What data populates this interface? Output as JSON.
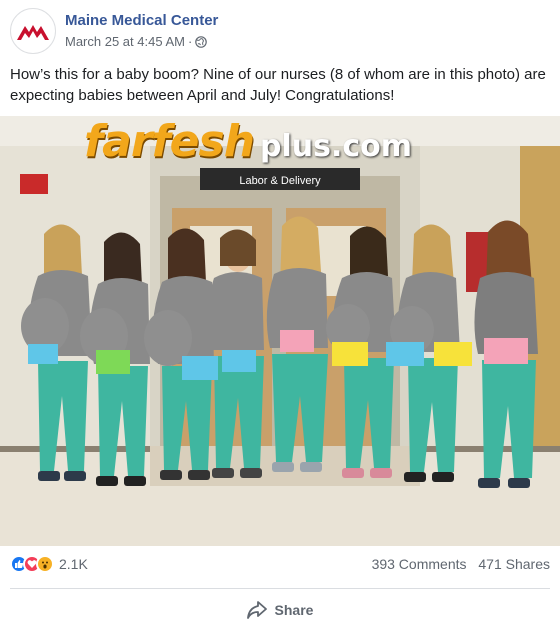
{
  "post": {
    "page_name": "Maine Medical Center",
    "timestamp": "March 25 at 4:45 AM",
    "separator": "·",
    "privacy_icon": "globe-icon",
    "text": "How’s this for a baby boom? Nine of our nurses (8 of whom are in this photo) are expecting babies between April and July! Congratulations!"
  },
  "photo": {
    "sign_text": "Labor & Delivery",
    "watermark_part1": "farfesh",
    "watermark_part2": "plus.com"
  },
  "stats": {
    "reaction_icons": [
      "like-icon",
      "love-icon",
      "wow-icon"
    ],
    "reactions_count": "2.1K",
    "comments": "393 Comments",
    "shares": "471 Shares"
  },
  "actions": {
    "share_label": "Share"
  },
  "colors": {
    "brand_blue": "#385898",
    "logo_red": "#c8102e",
    "scrubs_green": "#3fb6a0",
    "gray_shirt": "#8a8a8a"
  }
}
